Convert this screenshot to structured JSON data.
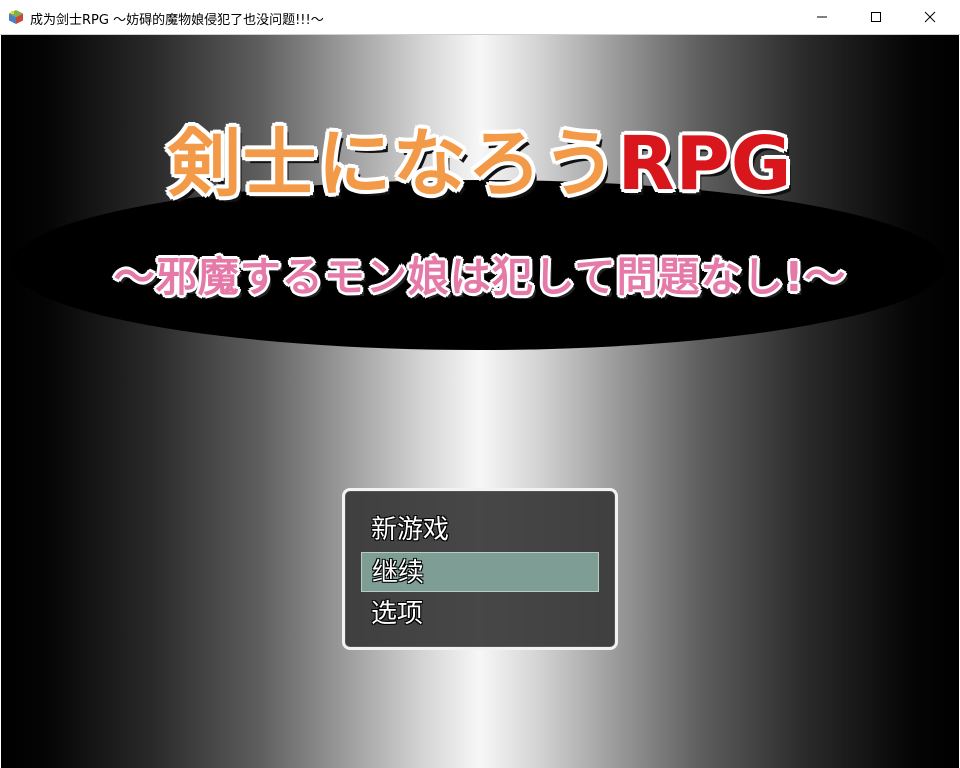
{
  "window": {
    "title": "成为剑士RPG ～妨碍的魔物娘侵犯了也没问题!!!～",
    "icon": "rpg-maker-cube-icon",
    "controls": [
      "minimize-icon",
      "maximize-icon",
      "close-icon"
    ]
  },
  "logo": {
    "main_jp": "剣士になろう",
    "main_rpg": "RPG",
    "subtitle": "～邪魔するモン娘は犯して問題なし!～",
    "colors": {
      "main": "#f29a48",
      "rpg": "#d8161c",
      "subtitle": "#e57aa8",
      "outline": "#ffffff"
    }
  },
  "menu": {
    "items": [
      {
        "label": "新游戏"
      },
      {
        "label": "继续",
        "selected": true
      },
      {
        "label": "选项"
      }
    ],
    "highlight_color": "#7e9e95"
  }
}
